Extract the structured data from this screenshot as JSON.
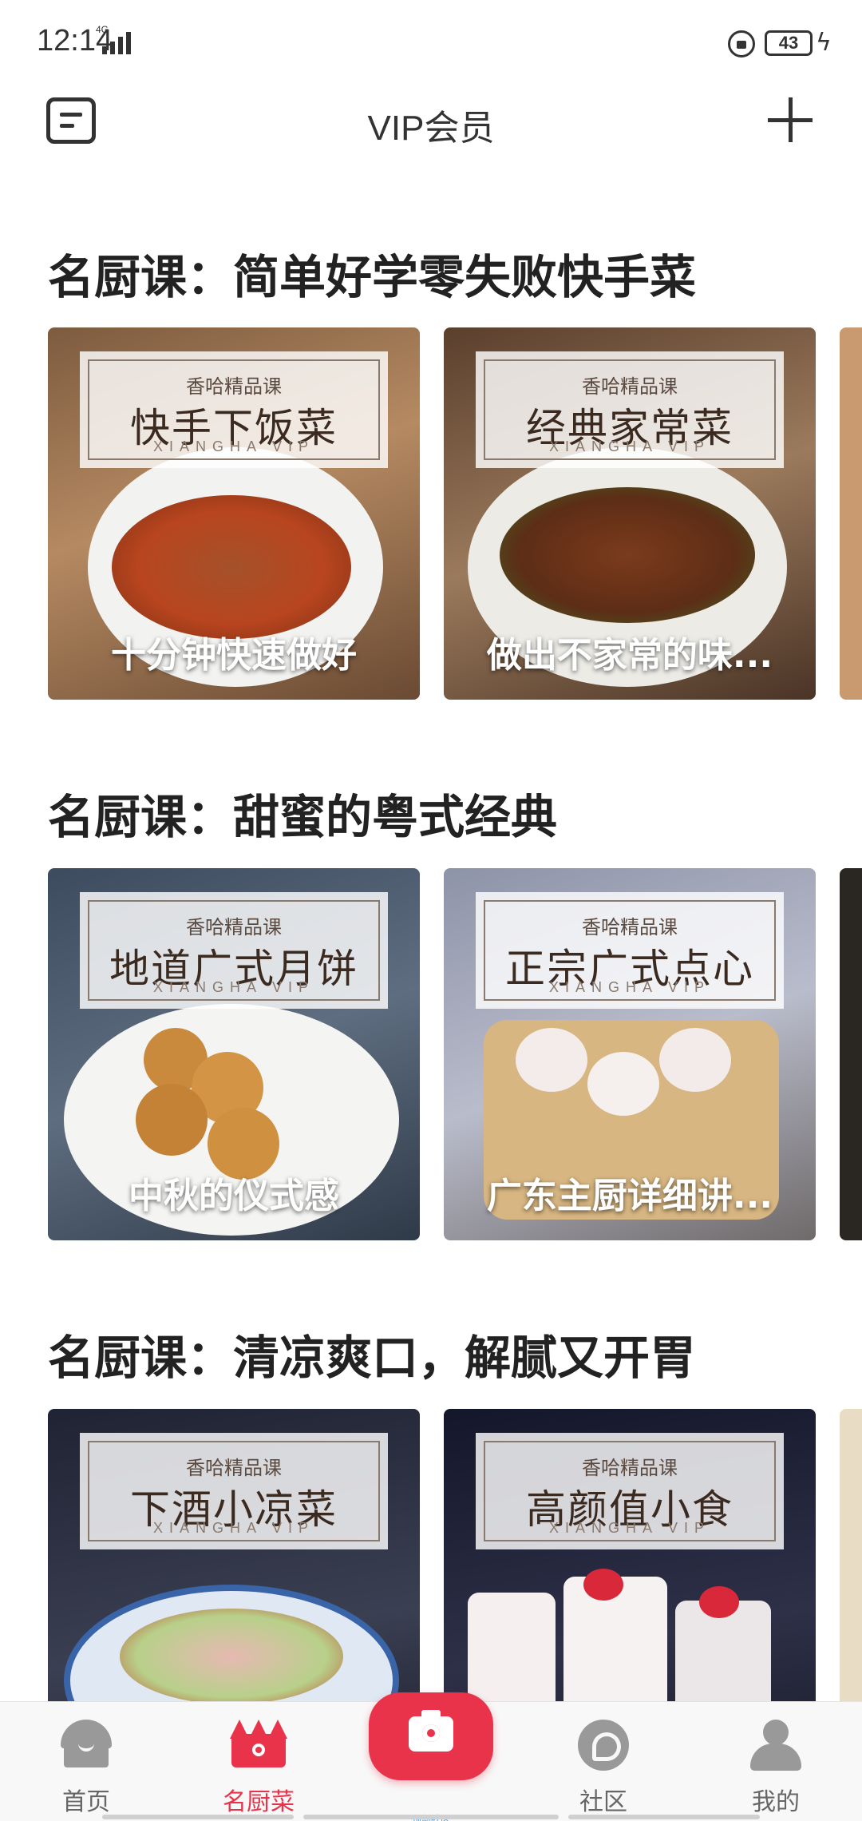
{
  "status_bar": {
    "time": "12:14",
    "network": "4G",
    "battery": "43",
    "battery_level": 0.43
  },
  "header": {
    "title": "VIP会员"
  },
  "sections": [
    {
      "title": "名厨课：简单好学零失败快手菜",
      "cards": [
        {
          "badge": "香哈精品课",
          "name": "快手下饭菜",
          "brand": "XIANGHA VIP",
          "caption": "十分钟快速做好"
        },
        {
          "badge": "香哈精品课",
          "name": "经典家常菜",
          "brand": "XIANGHA VIP",
          "caption": "做出不家常的味..."
        }
      ]
    },
    {
      "title": "名厨课：甜蜜的粤式经典",
      "cards": [
        {
          "badge": "香哈精品课",
          "name": "地道广式月饼",
          "brand": "XIANGHA VIP",
          "caption": "中秋的仪式感"
        },
        {
          "badge": "香哈精品课",
          "name": "正宗广式点心",
          "brand": "XIANGHA VIP",
          "caption": "广东主厨详细讲..."
        }
      ]
    },
    {
      "title": "名厨课：清凉爽口，解腻又开胃",
      "cards": [
        {
          "badge": "香哈精品课",
          "name": "下酒小凉菜",
          "brand": "XIANGHA VIP",
          "caption": ""
        },
        {
          "badge": "香哈精品课",
          "name": "高颜值小食",
          "brand": "XIANGHA VIP",
          "caption": ""
        }
      ]
    }
  ],
  "bottom_nav": {
    "items": [
      {
        "label": "首页",
        "icon": "home-icon"
      },
      {
        "label": "名厨菜",
        "icon": "crown-icon",
        "active": true
      },
      {
        "label": "",
        "icon": "camera-icon"
      },
      {
        "label": "社区",
        "icon": "community-icon"
      },
      {
        "label": "我的",
        "icon": "profile-icon"
      }
    ],
    "camera_caption": "顶部社区"
  },
  "colors": {
    "accent": "#e8334a",
    "inactive": "#999999",
    "text": "#222222"
  }
}
